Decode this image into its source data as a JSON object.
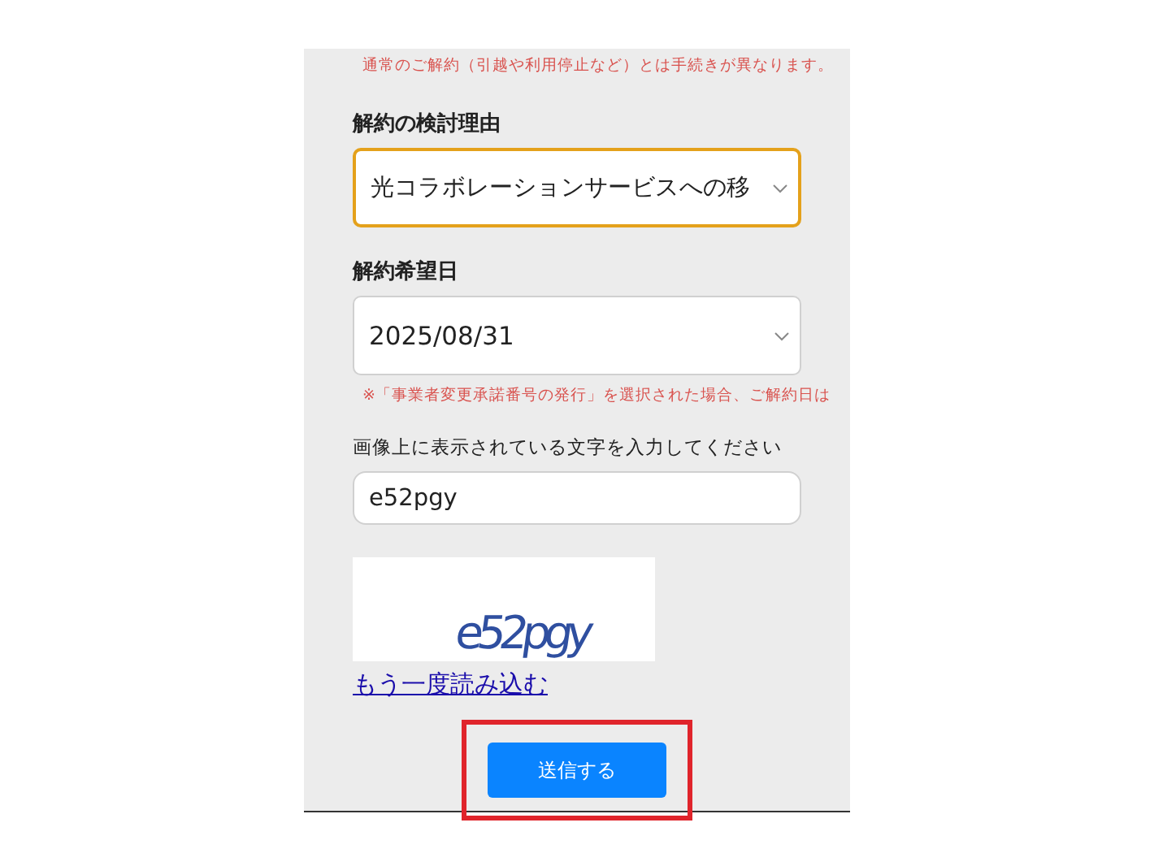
{
  "notice": "通常のご解約（引越や利用停止など）とは手続きが異なります。",
  "reason": {
    "label": "解約の検討理由",
    "value": "光コラボレーションサービスへの移",
    "focused": true
  },
  "date": {
    "label": "解約希望日",
    "value": "2025/08/31",
    "focused": false
  },
  "date_note": "※「事業者変更承諾番号の発行」を選択された場合、ご解約日は",
  "captcha": {
    "label": "画像上に表示されている文字を入力してください",
    "value": "e52pgy",
    "image_text": "e52pgy",
    "reload_link": "もう一度読み込む"
  },
  "submit": {
    "label": "送信する",
    "highlighted": true
  }
}
